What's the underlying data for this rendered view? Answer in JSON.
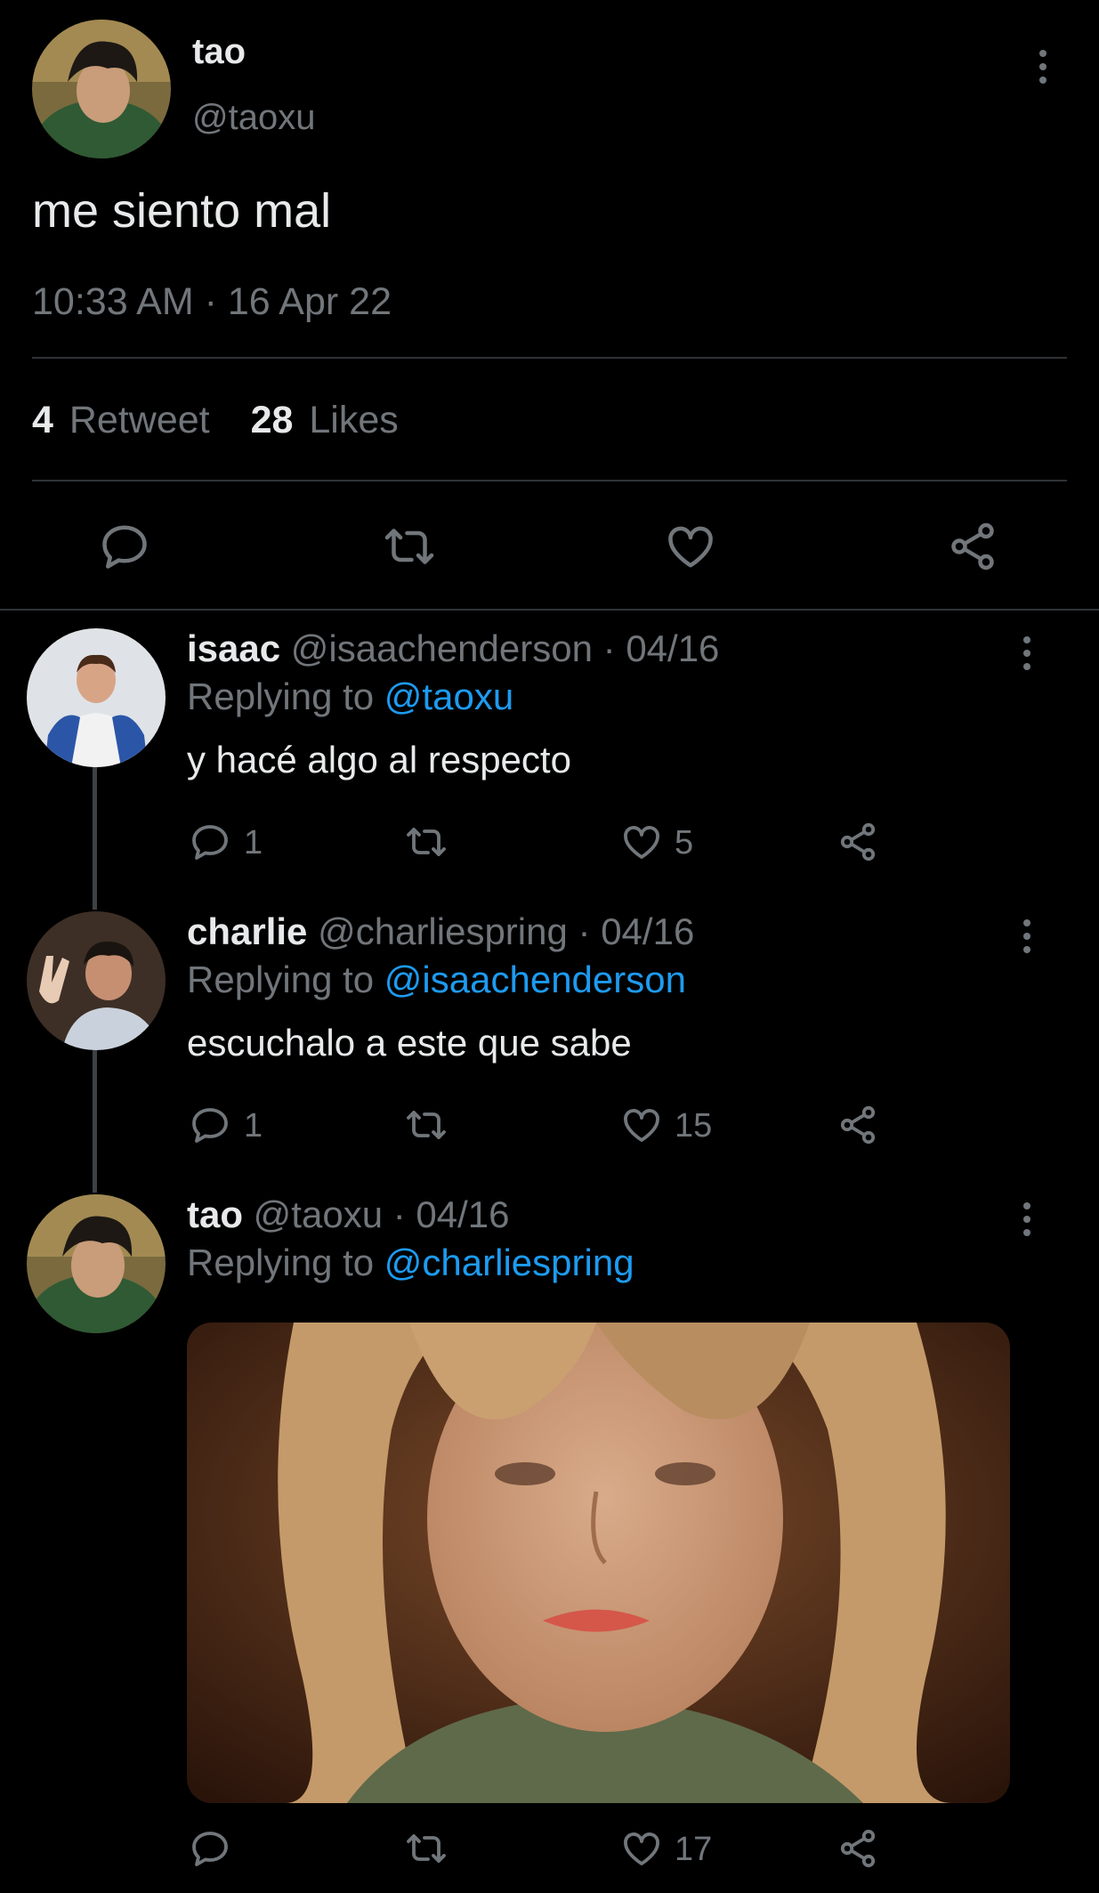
{
  "main_tweet": {
    "author_name": "tao",
    "author_handle": "@taoxu",
    "text": "me siento mal",
    "timestamp": "10:33 AM · 16 Apr 22",
    "retweet_count": "4",
    "retweet_label": "Retweet",
    "like_count": "28",
    "like_label": "Likes"
  },
  "replies": [
    {
      "author_name": "isaac",
      "author_handle": "@isaachenderson",
      "date": "04/16",
      "replying_prefix": "Replying to",
      "replying_to": "@taoxu",
      "text": "y hacé algo al respecto",
      "reply_count": "1",
      "retweet_count": "",
      "like_count": "5"
    },
    {
      "author_name": "charlie",
      "author_handle": "@charliespring",
      "date": "04/16",
      "replying_prefix": "Replying to",
      "replying_to": "@isaachenderson",
      "text": "escuchalo a este que sabe",
      "reply_count": "1",
      "retweet_count": "",
      "like_count": "15"
    },
    {
      "author_name": "tao",
      "author_handle": "@taoxu",
      "date": "04/16",
      "replying_prefix": "Replying to",
      "replying_to": "@charliespring",
      "text": "",
      "reply_count": "",
      "retweet_count": "",
      "like_count": "17"
    }
  ],
  "separator": "·",
  "colors": {
    "background": "#000000",
    "text": "#e7e9ea",
    "secondary": "#71767b",
    "link": "#1d9bf0",
    "divider": "#2f3336"
  },
  "icons": [
    "more-vertical-icon",
    "reply-icon",
    "retweet-icon",
    "like-icon",
    "share-icon"
  ]
}
